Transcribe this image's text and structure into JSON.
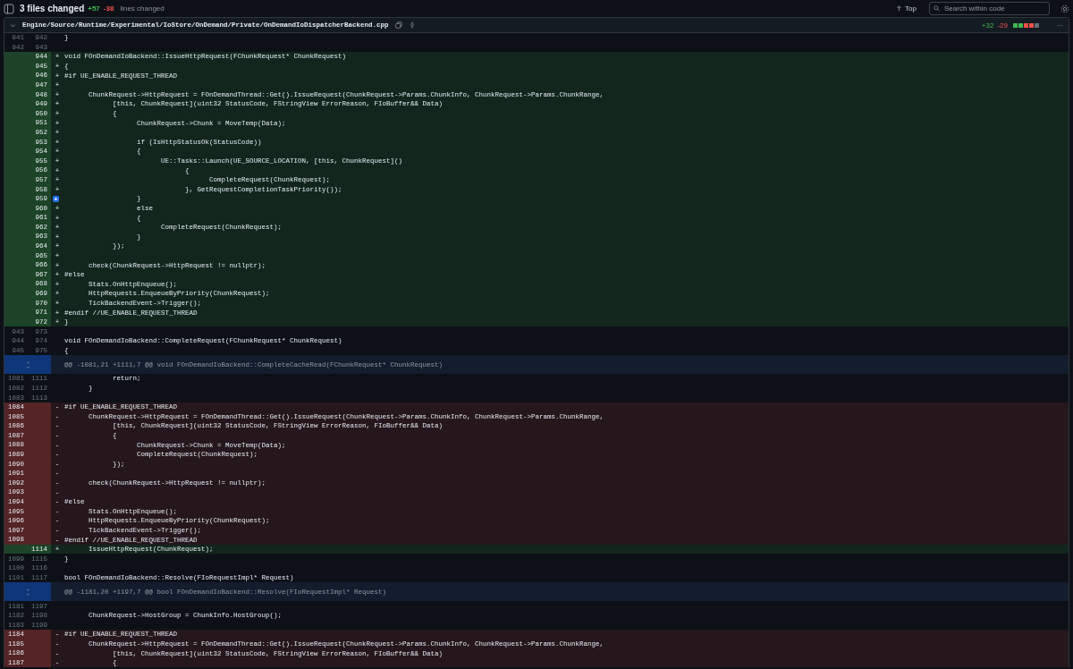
{
  "summary": {
    "files_changed": "3 files changed",
    "additions": "+57",
    "deletions": "-38",
    "lines_label": "lines changed"
  },
  "toolbar": {
    "top_link": "Top",
    "search": {
      "placeholder": "Search within code"
    }
  },
  "file": {
    "path": "Engine/Source/Runtime/Experimental/IoStore/OnDemand/Private/OnDemandIoDispatcherBackend.cpp",
    "additions": "+32",
    "deletions": "-29",
    "diffstat_blocks": [
      {
        "color": "#3fb950"
      },
      {
        "color": "#3fb950"
      },
      {
        "color": "#f85149"
      },
      {
        "color": "#f85149"
      },
      {
        "color": "#656c76"
      }
    ],
    "more": "···"
  },
  "rows": [
    {
      "kind": "context",
      "old": "941",
      "new": "942",
      "code": "}"
    },
    {
      "kind": "context",
      "old": "942",
      "new": "943"
    },
    {
      "kind": "added",
      "new": "944",
      "sign": "+",
      "code": "void FOnDemandIoBackend::IssueHttpRequest(FChunkRequest* ChunkRequest)"
    },
    {
      "kind": "added",
      "new": "945",
      "sign": "+",
      "code": "{"
    },
    {
      "kind": "added",
      "new": "946",
      "sign": "+",
      "code": "#if UE_ENABLE_REQUEST_THREAD"
    },
    {
      "kind": "added",
      "new": "947",
      "sign": "+"
    },
    {
      "kind": "added",
      "new": "948",
      "sign": "+",
      "code": "\tChunkRequest->HttpRequest = FOnDemandThread::Get().IssueRequest(ChunkRequest->Params.ChunkInfo, ChunkRequest->Params.ChunkRange,"
    },
    {
      "kind": "added",
      "new": "949",
      "sign": "+",
      "code": "\t\t[this, ChunkRequest](uint32 StatusCode, FStringView ErrorReason, FIoBuffer&& Data)"
    },
    {
      "kind": "added",
      "new": "950",
      "sign": "+",
      "code": "\t\t{"
    },
    {
      "kind": "added",
      "new": "951",
      "sign": "+",
      "code": "\t\t\tChunkRequest->Chunk = MoveTemp(Data);"
    },
    {
      "kind": "added",
      "new": "952",
      "sign": "+"
    },
    {
      "kind": "added",
      "new": "953",
      "sign": "+",
      "code": "\t\t\tif (IsHttpStatusOk(StatusCode))"
    },
    {
      "kind": "added",
      "new": "954",
      "sign": "+",
      "code": "\t\t\t{"
    },
    {
      "kind": "added",
      "new": "955",
      "sign": "+",
      "code": "\t\t\t\tUE::Tasks::Launch(UE_SOURCE_LOCATION, [this, ChunkRequest]()"
    },
    {
      "kind": "added",
      "new": "956",
      "sign": "+",
      "code": "\t\t\t\t\t{"
    },
    {
      "kind": "added",
      "new": "957",
      "sign": "+",
      "code": "\t\t\t\t\t\tCompleteRequest(ChunkRequest);"
    },
    {
      "kind": "added",
      "new": "958",
      "sign": "+",
      "code": "\t\t\t\t\t}, GetRequestCompletionTaskPriority());"
    },
    {
      "kind": "added",
      "new": "959",
      "hovered": true,
      "code": "\t\t\t}"
    },
    {
      "kind": "added",
      "new": "960",
      "sign": "+",
      "code": "\t\t\telse"
    },
    {
      "kind": "added",
      "new": "961",
      "sign": "+",
      "code": "\t\t\t{"
    },
    {
      "kind": "added",
      "new": "962",
      "sign": "+",
      "code": "\t\t\t\tCompleteRequest(ChunkRequest);"
    },
    {
      "kind": "added",
      "new": "963",
      "sign": "+",
      "code": "\t\t\t}"
    },
    {
      "kind": "added",
      "new": "964",
      "sign": "+",
      "code": "\t\t});"
    },
    {
      "kind": "added",
      "new": "965",
      "sign": "+"
    },
    {
      "kind": "added",
      "new": "966",
      "sign": "+",
      "code": "\tcheck(ChunkRequest->HttpRequest != nullptr);"
    },
    {
      "kind": "added",
      "new": "967",
      "sign": "+",
      "code": "#else"
    },
    {
      "kind": "added",
      "new": "968",
      "sign": "+",
      "code": "\tStats.OnHttpEnqueue();"
    },
    {
      "kind": "added",
      "new": "969",
      "sign": "+",
      "code": "\tHttpRequests.EnqueueByPriority(ChunkRequest);"
    },
    {
      "kind": "added",
      "new": "970",
      "sign": "+",
      "code": "\tTickBackendEvent->Trigger();"
    },
    {
      "kind": "added",
      "new": "971",
      "sign": "+",
      "code": "#endif //UE_ENABLE_REQUEST_THREAD"
    },
    {
      "kind": "added",
      "new": "972",
      "sign": "+",
      "code": "}"
    },
    {
      "kind": "context",
      "old": "943",
      "new": "973"
    },
    {
      "kind": "context",
      "old": "944",
      "new": "974",
      "code": "void FOnDemandIoBackend::CompleteRequest(FChunkRequest* ChunkRequest)"
    },
    {
      "kind": "context",
      "old": "945",
      "new": "975",
      "code": "{"
    },
    {
      "kind": "hunk",
      "code": "@@ -1081,21 +1111,7 @@ void FOnDemandIoBackend::CompleteCacheRead(FChunkRequest* ChunkRequest)"
    },
    {
      "kind": "context",
      "old": "1081",
      "new": "1111",
      "code": "\t\treturn;"
    },
    {
      "kind": "context",
      "old": "1082",
      "new": "1112",
      "code": "\t}"
    },
    {
      "kind": "context",
      "old": "1083",
      "new": "1113"
    },
    {
      "kind": "deleted",
      "old": "1084",
      "sign": "-",
      "code": "#if UE_ENABLE_REQUEST_THREAD"
    },
    {
      "kind": "deleted",
      "old": "1085",
      "sign": "-",
      "code": "\tChunkRequest->HttpRequest = FOnDemandThread::Get().IssueRequest(ChunkRequest->Params.ChunkInfo, ChunkRequest->Params.ChunkRange,"
    },
    {
      "kind": "deleted",
      "old": "1086",
      "sign": "-",
      "code": "\t\t[this, ChunkRequest](uint32 StatusCode, FStringView ErrorReason, FIoBuffer&& Data)"
    },
    {
      "kind": "deleted",
      "old": "1087",
      "sign": "-",
      "code": "\t\t{"
    },
    {
      "kind": "deleted",
      "old": "1088",
      "sign": "-",
      "code": "\t\t\tChunkRequest->Chunk = MoveTemp(Data);"
    },
    {
      "kind": "deleted",
      "old": "1089",
      "sign": "-",
      "code": "\t\t\tCompleteRequest(ChunkRequest);"
    },
    {
      "kind": "deleted",
      "old": "1090",
      "sign": "-",
      "code": "\t\t});"
    },
    {
      "kind": "deleted",
      "old": "1091",
      "sign": "-"
    },
    {
      "kind": "deleted",
      "old": "1092",
      "sign": "-",
      "code": "\tcheck(ChunkRequest->HttpRequest != nullptr);"
    },
    {
      "kind": "deleted",
      "old": "1093",
      "sign": "-"
    },
    {
      "kind": "deleted",
      "old": "1094",
      "sign": "-",
      "code": "#else"
    },
    {
      "kind": "deleted",
      "old": "1095",
      "sign": "-",
      "code": "\tStats.OnHttpEnqueue();"
    },
    {
      "kind": "deleted",
      "old": "1096",
      "sign": "-",
      "code": "\tHttpRequests.EnqueueByPriority(ChunkRequest);"
    },
    {
      "kind": "deleted",
      "old": "1097",
      "sign": "-",
      "code": "\tTickBackendEvent->Trigger();"
    },
    {
      "kind": "deleted",
      "old": "1098",
      "sign": "-",
      "code": "#endif //UE_ENABLE_REQUEST_THREAD"
    },
    {
      "kind": "added",
      "new": "1114",
      "sign": "+",
      "code": "\tIssueHttpRequest(ChunkRequest);"
    },
    {
      "kind": "context",
      "old": "1099",
      "new": "1115",
      "code": "}"
    },
    {
      "kind": "context",
      "old": "1100",
      "new": "1116"
    },
    {
      "kind": "context",
      "old": "1101",
      "new": "1117",
      "code": "bool FOnDemandIoBackend::Resolve(FIoRequestImpl* Request)"
    },
    {
      "kind": "hunk",
      "code": "@@ -1181,20 +1197,7 @@ bool FOnDemandIoBackend::Resolve(FIoRequestImpl* Request)"
    },
    {
      "kind": "context",
      "old": "1181",
      "new": "1197"
    },
    {
      "kind": "context",
      "old": "1182",
      "new": "1198",
      "code": "\tChunkRequest->HostGroup = ChunkInfo.HostGroup();"
    },
    {
      "kind": "context",
      "old": "1183",
      "new": "1199"
    },
    {
      "kind": "deleted",
      "old": "1184",
      "sign": "-",
      "code": "#if UE_ENABLE_REQUEST_THREAD"
    },
    {
      "kind": "deleted",
      "old": "1185",
      "sign": "-",
      "code": "\tChunkRequest->HttpRequest = FOnDemandThread::Get().IssueRequest(ChunkRequest->Params.ChunkInfo, ChunkRequest->Params.ChunkRange,"
    },
    {
      "kind": "deleted",
      "old": "1186",
      "sign": "-",
      "code": "\t\t[this, ChunkRequest](uint32 StatusCode, FStringView ErrorReason, FIoBuffer&& Data)"
    },
    {
      "kind": "deleted",
      "old": "1187",
      "sign": "-",
      "code": "\t\t{"
    }
  ]
}
